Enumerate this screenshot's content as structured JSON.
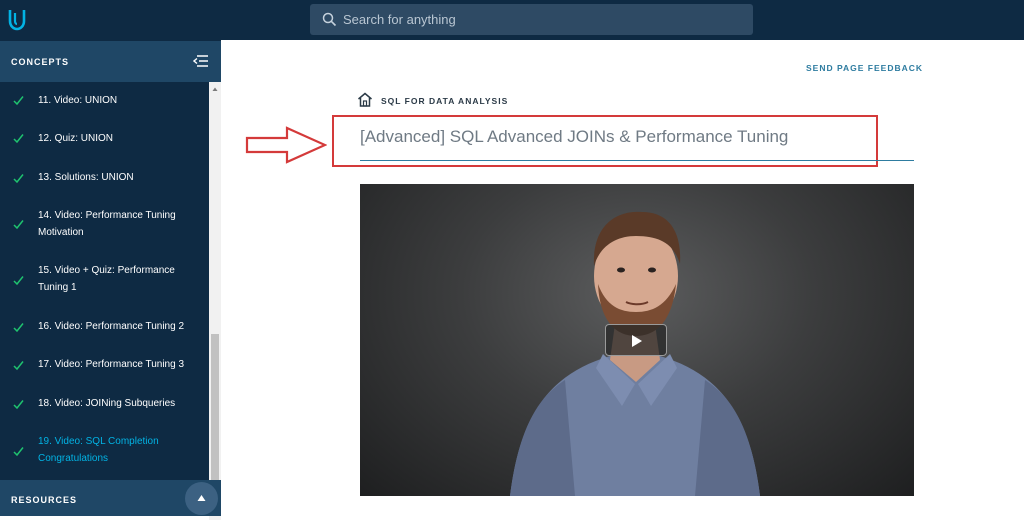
{
  "header": {
    "logo": "udacity-logo-icon",
    "search": {
      "placeholder": "Search for anything",
      "icon": "search-icon"
    }
  },
  "sidebar": {
    "concepts_label": "CONCEPTS",
    "items": [
      {
        "label": "11. Video: UNION",
        "status": "complete"
      },
      {
        "label": "12. Quiz: UNION",
        "status": "complete"
      },
      {
        "label": "13. Solutions: UNION",
        "status": "complete"
      },
      {
        "label": "14. Video: Performance Tuning Motivation",
        "status": "complete"
      },
      {
        "label": "15. Video + Quiz: Performance Tuning 1",
        "status": "complete"
      },
      {
        "label": "16. Video: Performance Tuning 2",
        "status": "complete"
      },
      {
        "label": "17. Video: Performance Tuning 3",
        "status": "complete"
      },
      {
        "label": "18. Video: JOINing Subqueries",
        "status": "complete"
      },
      {
        "label": "19. Video: SQL Completion Congratulations",
        "status": "active"
      }
    ],
    "resources_label": "RESOURCES"
  },
  "main": {
    "feedback_label": "SEND PAGE FEEDBACK",
    "course_name": "SQL FOR DATA ANALYSIS",
    "lesson_title": "[Advanced] SQL Advanced JOINs & Performance Tuning"
  },
  "colors": {
    "topbar": "#0e2a43",
    "sidebar_header": "#1f4766",
    "accent": "#02b3e4",
    "check": "#1fc36f",
    "annotation_red": "#d43a3a"
  }
}
